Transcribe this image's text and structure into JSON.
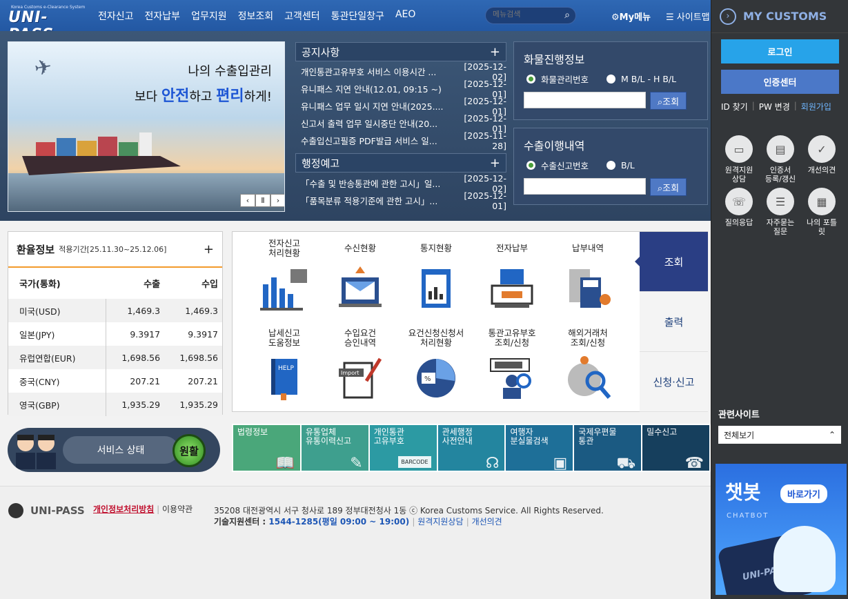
{
  "header": {
    "logo_sub": "Korea Customs e-Clearance System",
    "logo": "UNI-PASS",
    "nav": [
      "전자신고",
      "전자납부",
      "업무지원",
      "정보조회",
      "고객센터",
      "통관단일창구",
      "AEO"
    ],
    "search_placeholder": "메뉴검색",
    "my_menu": "My메뉴",
    "sitemap": "사이트맵"
  },
  "banner": {
    "line1": "나의 수출입관리",
    "line2_pre": "보다 ",
    "line2_a": "안전",
    "line2_mid": "하고 ",
    "line2_b": "편리",
    "line2_post": "하게!"
  },
  "notices": {
    "title": "공지사항",
    "items": [
      {
        "title": "개인통관고유부호 서비스 이용시간 ...",
        "date": "[2025-12-02]"
      },
      {
        "title": "유니패스 지연 안내(12.01, 09:15 ~)",
        "date": "[2025-12-01]"
      },
      {
        "title": "유니패스 업무 일시 지연 안내(2025....",
        "date": "[2025-12-01]"
      },
      {
        "title": "신고서 출력 업무 일시중단 안내(20...",
        "date": "[2025-12-01]"
      },
      {
        "title": "수출입신고필증 PDF발급 서비스 일...",
        "date": "[2025-11-28]"
      }
    ]
  },
  "admin_notices": {
    "title": "행정예고",
    "items": [
      {
        "title": "「수출 및 반송통관에 관한 고시」일...",
        "date": "[2025-12-02]"
      },
      {
        "title": "「품목분류 적용기준에 관한 고시」...",
        "date": "[2025-12-01]"
      }
    ]
  },
  "cargo": {
    "title": "화물진행정보",
    "radio1": "화물관리번호",
    "radio2": "M B/L - H B/L",
    "button": "조회"
  },
  "export": {
    "title": "수출이행내역",
    "radio1": "수출신고번호",
    "radio2": "B/L",
    "button": "조회"
  },
  "exchange": {
    "title": "환율정보",
    "period": "적용기간[25.11.30~25.12.06]",
    "headers": [
      "국가(통화)",
      "수출",
      "수입"
    ],
    "rows": [
      [
        "미국(USD)",
        "1,469.3",
        "1,469.3"
      ],
      [
        "일본(JPY)",
        "9.3917",
        "9.3917"
      ],
      [
        "유럽연합(EUR)",
        "1,698.56",
        "1,698.56"
      ],
      [
        "중국(CNY)",
        "207.21",
        "207.21"
      ],
      [
        "영국(GBP)",
        "1,935.29",
        "1,935.29"
      ]
    ]
  },
  "services": [
    "전자신고\n처리현황",
    "수신현황",
    "통지현황",
    "전자납부",
    "납부내역",
    "납세신고\n도움정보",
    "수입요건\n승인내역",
    "요건신청신청서\n처리현황",
    "통관고유부호\n조회/신청",
    "해외거래처\n조회/신청"
  ],
  "service_tabs": [
    "조회",
    "출력",
    "신청·신고"
  ],
  "status": {
    "label": "서비스 상태",
    "value": "원활"
  },
  "quick_links": [
    {
      "label": "법령정보",
      "color": "#4aa77a"
    },
    {
      "label": "유통업체\n유통이력신고",
      "color": "#3e9f8e"
    },
    {
      "label": "개인통관\n고유부호",
      "color": "#2c9aa3"
    },
    {
      "label": "관세행정\n사전안내",
      "color": "#23859f"
    },
    {
      "label": "여행자\n분실물검색",
      "color": "#1e6f98"
    },
    {
      "label": "국제우편물\n통관",
      "color": "#1b5a82"
    },
    {
      "label": "밀수신고",
      "color": "#163f5d"
    }
  ],
  "quick_icon_text": "BARCODE",
  "footer": {
    "brand": "UNI-PASS",
    "privacy": "개인정보처리방침",
    "terms": "이용약관",
    "address": "35208 대전광역시 서구 청사로 189 정부대전청사 1동 ⓒ Korea Customs Service. All Rights Reserved.",
    "tel_label": "기술지원센터 : ",
    "tel": "1544-1285(평일 09:00 ~ 19:00)",
    "remote": "원격지원상담",
    "feedback": "개선의견"
  },
  "side": {
    "title": "MY CUSTOMS",
    "login": "로그인",
    "cert": "인증센터",
    "find_id": "ID 찾기",
    "pw": "PW 변경",
    "join": "회원가입",
    "icons": [
      "원격지원\n상담",
      "인증서\n등록/갱신",
      "개선의견",
      "질의응답",
      "자주묻는\n질문",
      "나의 포틀\n릿"
    ],
    "related_title": "관련사이트",
    "related_select": "전체보기",
    "chatbot": "챗봇",
    "chatbot_sub": "CHATBOT",
    "chatbot_go": "바로가기",
    "chatbot_brand": "UNI-PASS"
  }
}
